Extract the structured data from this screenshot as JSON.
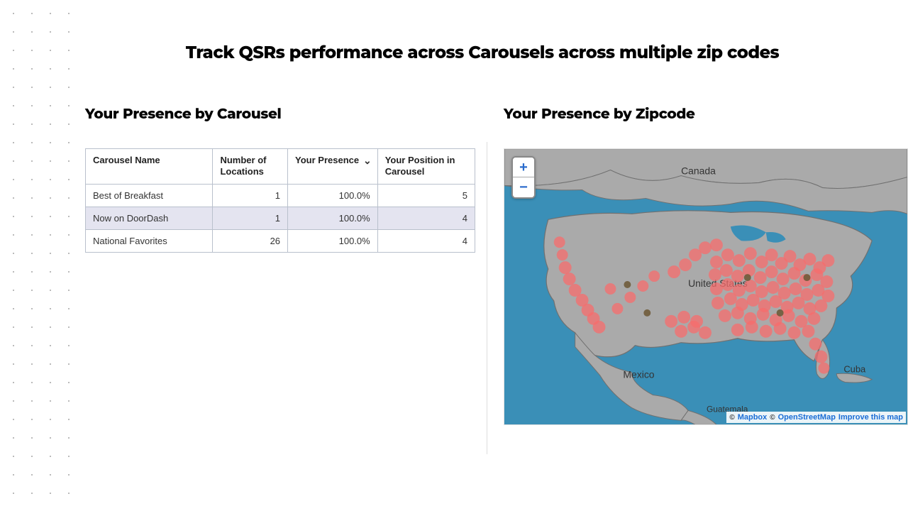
{
  "page_title": "Track QSRs performance across Carousels across multiple zip codes",
  "left": {
    "heading": "Your Presence by Carousel",
    "columns": [
      "Carousel Name",
      "Number of Locations",
      "Your Presence",
      "Your Position in Carousel"
    ],
    "sort_column": "Your Presence",
    "sort_direction": "desc",
    "rows": [
      {
        "name": "Best of Breakfast",
        "locations": "1",
        "presence": "100.0%",
        "position": "5"
      },
      {
        "name": "Now on DoorDash",
        "locations": "1",
        "presence": "100.0%",
        "position": "4"
      },
      {
        "name": "National Favorites",
        "locations": "26",
        "presence": "100.0%",
        "position": "4"
      }
    ]
  },
  "right": {
    "heading": "Your Presence by Zipcode",
    "map": {
      "zoom_in": "+",
      "zoom_out": "−",
      "labels": {
        "canada": "Canada",
        "united_states": "United States",
        "mexico": "Mexico",
        "cuba": "Cuba",
        "guatemala": "Guatemala"
      },
      "attribution": {
        "mapbox": "Mapbox",
        "osm": "OpenStreetMap",
        "improve": "Improve this map"
      },
      "colors": {
        "ocean": "#3a8fb7",
        "land": "#aaaaaa",
        "outline": "#707070",
        "dot_fill": "#f76c6c",
        "dot_dark": "#6f5b3a"
      }
    }
  }
}
